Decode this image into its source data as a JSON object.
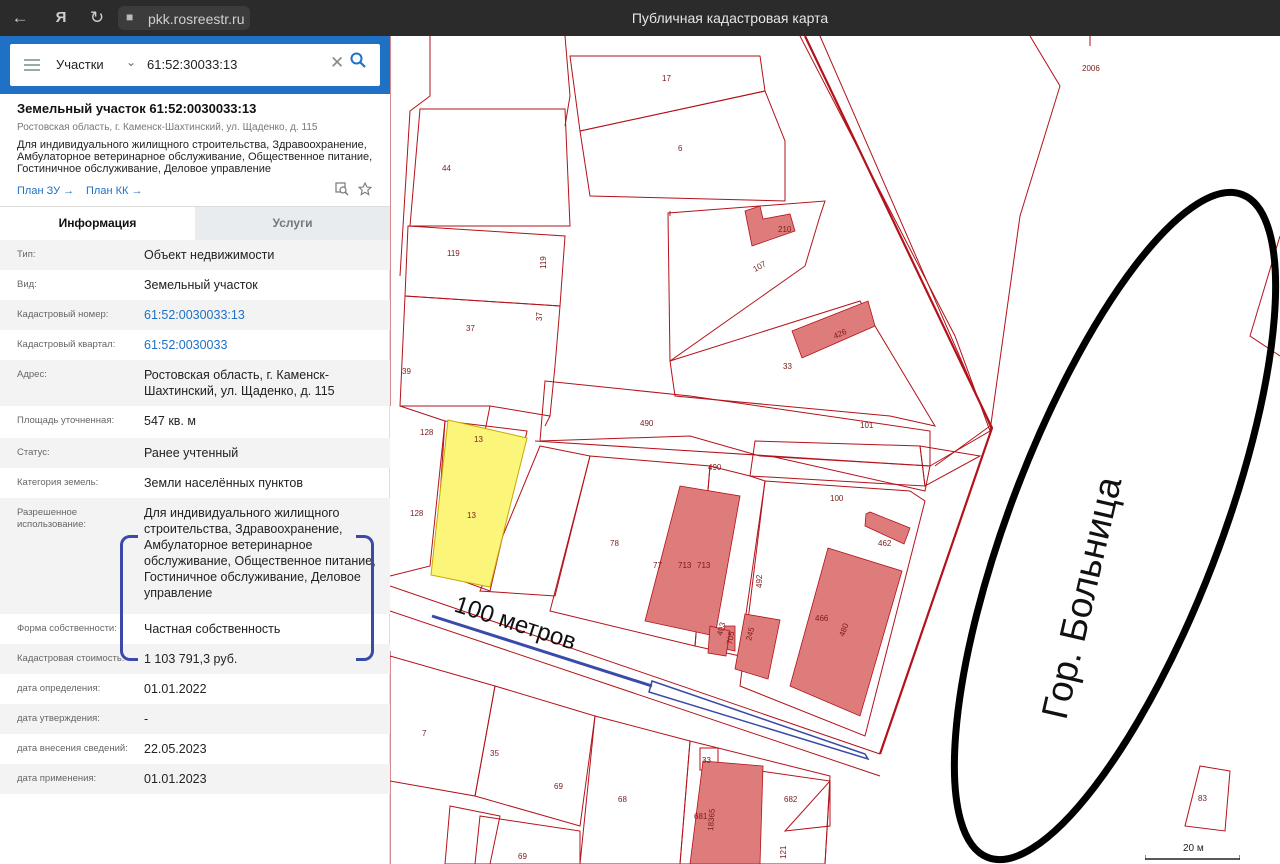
{
  "browser": {
    "url": "pkk.rosreestr.ru",
    "title": "Публичная кадастровая карта",
    "back_icon": "←",
    "yandex_icon": "Я",
    "reload_icon": "↻",
    "lock_icon": "🔒"
  },
  "search": {
    "type": "Участки",
    "value": "61:52:30033:13",
    "clear_icon": "✕",
    "search_icon": "⚲"
  },
  "object": {
    "title": "Земельный участок 61:52:0030033:13",
    "address": "Ростовская область, г. Каменск-Шахтинский, ул. Щаденко, д. 115",
    "use": "Для индивидуального жилищного строительства, Здравоохранение, Амбулаторное ветеринарное обслуживание, Общественное питание, Гостиничное обслуживание, Деловое управление",
    "plan_zu": "План ЗУ →",
    "plan_kk": "План КК →"
  },
  "tabs": {
    "info": "Информация",
    "services": "Услуги"
  },
  "info": [
    {
      "label": "Тип:",
      "value": "Объект недвижимости"
    },
    {
      "label": "Вид:",
      "value": "Земельный участок"
    },
    {
      "label": "Кадастровый номер:",
      "value": "61:52:0030033:13"
    },
    {
      "label": "Кадастровый квартал:",
      "value": "61:52:0030033"
    },
    {
      "label": "Адрес:",
      "value": "Ростовская область, г. Каменск-Шахтинский, ул. Щаденко, д. 115"
    },
    {
      "label": "Площадь уточненная:",
      "value": "547 кв. м"
    },
    {
      "label": "Статус:",
      "value": "Ранее учтенный"
    },
    {
      "label": "Категория земель:",
      "value": "Земли населённых пунктов"
    },
    {
      "label": "Разрешенное использование:",
      "value": "Для индивидуального жилищного строительства, Здравоохранение, Амбулаторное ветеринарное обслуживание, Общественное питание, Гостиничное обслуживание, Деловое управление"
    },
    {
      "label": "Форма собственности:",
      "value": "Частная собственность"
    },
    {
      "label": "Кадастровая стоимость:",
      "value": "1 103 791,3 руб."
    },
    {
      "label": "дата определения:",
      "value": "01.01.2022"
    },
    {
      "label": "дата утверждения:",
      "value": "-"
    },
    {
      "label": "дата внесения сведений:",
      "value": "22.05.2023"
    },
    {
      "label": "дата применения:",
      "value": "01.01.2023"
    }
  ],
  "map": {
    "annotation_distance": "100 метров",
    "annotation_hospital": "Гор. Больница",
    "scale_label": "20 м",
    "parcel_labels": [
      "2006",
      "17",
      "6",
      "44",
      "210",
      "107",
      "119",
      "119",
      "37",
      "37",
      "426",
      "33",
      "39",
      "490",
      "101",
      "128",
      "13",
      "13",
      "490",
      "100",
      "128",
      "78",
      "77",
      "713",
      "713",
      "492",
      "462",
      "466",
      "480",
      "245",
      "493",
      "705",
      "7",
      "35",
      "33",
      "69",
      "68",
      "681",
      "18365",
      "682",
      "83",
      "69",
      "121"
    ],
    "colors": {
      "parcel_line": "#b3121a",
      "building_fill": "#de7b7b",
      "selected_fill": "#fbf67a",
      "annotation": "#3a4aa8"
    }
  }
}
